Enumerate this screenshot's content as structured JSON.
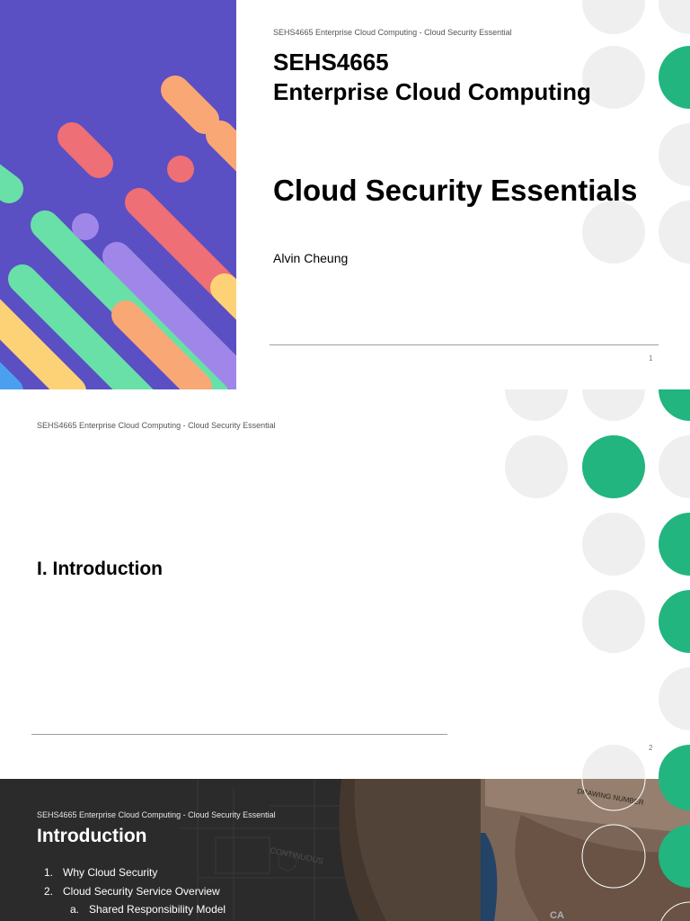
{
  "slides": [
    {
      "header": "SEHS4665 Enterprise Cloud Computing - Cloud Security Essential",
      "course_code": "SEHS4665",
      "course_name": "Enterprise Cloud Computing",
      "title": "Cloud Security Essentials",
      "author": "Alvin Cheung",
      "page_number": "1"
    },
    {
      "header": "SEHS4665 Enterprise Cloud Computing - Cloud Security Essential",
      "title": "I. Introduction",
      "page_number": "2"
    },
    {
      "header": "SEHS4665 Enterprise Cloud Computing - Cloud Security Essential",
      "title": "Introduction",
      "list": [
        {
          "marker": "1.",
          "text": "Why Cloud Security"
        },
        {
          "marker": "2.",
          "text": "Cloud Security Service Overview"
        },
        {
          "marker": "a.",
          "text": "Shared Responsibility Model"
        }
      ],
      "photo_labels": [
        "DRAWING NUMBER",
        "CONTINUOUS",
        "CA"
      ]
    }
  ],
  "colors": {
    "purple": "#5b4fc4",
    "peach": "#f9a774",
    "coral": "#ee6f75",
    "lavender": "#a186ea",
    "mint": "#68e0a8",
    "yellow": "#fdd277",
    "green": "#22b57f",
    "gray_dot": "#efefef"
  }
}
